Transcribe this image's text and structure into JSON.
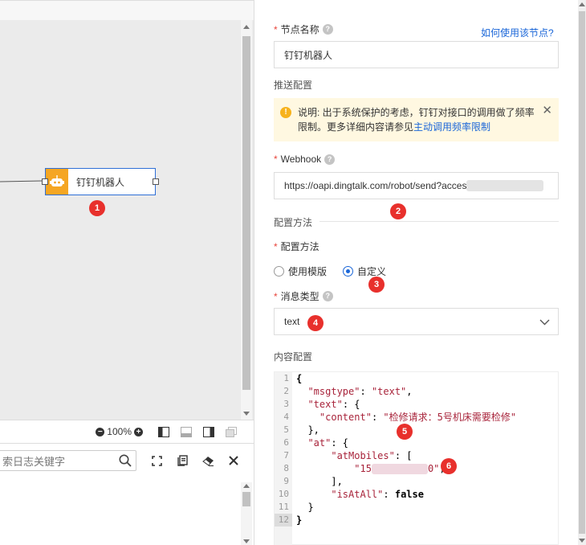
{
  "canvas": {
    "node": {
      "label": "钉钉机器人",
      "icon": "robot-icon"
    },
    "badge_1": "1"
  },
  "toolbar": {
    "zoom_level": "100%",
    "icons": [
      "zoom-out-icon",
      "zoom-in-icon",
      "layout-left-icon",
      "layout-bottom-icon",
      "layout-right-icon",
      "layout-float-icon"
    ]
  },
  "log": {
    "search_placeholder": "索日志关键字",
    "actions": [
      "fullscreen-icon",
      "copy-icon",
      "eraser-icon",
      "close-icon"
    ]
  },
  "form": {
    "node_name_label": "节点名称",
    "help_link": "如何使用该节点?",
    "node_name_value": "钉钉机器人",
    "push_config_section": "推送配置",
    "notice_text": "说明: 出于系统保护的考虑，钉钉对接口的调用做了频率限制。更多详细内容请参见",
    "notice_link": "主动调用频率限制",
    "webhook_label": "Webhook",
    "webhook_value": "https://oapi.dingtalk.com/robot/send?acces",
    "badge_2": "2",
    "config_method_section": "配置方法",
    "config_method_label": "配置方法",
    "radio_template": "使用模版",
    "radio_custom": "自定义",
    "badge_3": "3",
    "msg_type_label": "消息类型",
    "msg_type_value": "text",
    "badge_4": "4",
    "content_config_section": "内容配置"
  },
  "editor": {
    "line_numbers": [
      "1",
      "2",
      "3",
      "4",
      "5",
      "6",
      "7",
      "8",
      "9",
      "10",
      "11",
      "12"
    ],
    "l1": "{",
    "l2_key": "\"msgtype\"",
    "l2_val": "\"text\"",
    "l3_key": "\"text\"",
    "l4_key": "\"content\"",
    "l4_val": "\"检修请求：5号机床需要检修\"",
    "l5": "},",
    "l6_key": "\"at\"",
    "l7_key": "\"atMobiles\"",
    "l8_pre": "\"15",
    "l8_post": "0\"",
    "l9": "],",
    "l10_key": "\"isAtAll\"",
    "l10_val": "false",
    "l11": "}",
    "l12": "}",
    "badge_5": "5",
    "badge_6": "6"
  }
}
